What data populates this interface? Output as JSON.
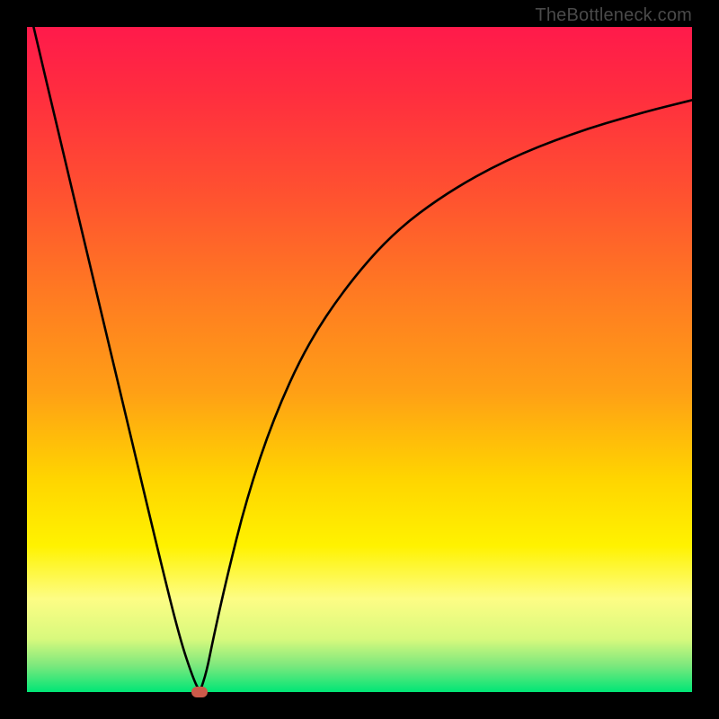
{
  "watermark": "TheBottleneck.com",
  "chart_data": {
    "type": "line",
    "title": "",
    "xlabel": "",
    "ylabel": "",
    "xlim": [
      0,
      100
    ],
    "ylim": [
      0,
      100
    ],
    "grid": false,
    "legend": false,
    "annotations": [],
    "series": [
      {
        "name": "left-branch",
        "x": [
          1,
          5,
          10,
          15,
          20,
          23,
          25,
          26
        ],
        "values": [
          100,
          83,
          62,
          41,
          20,
          8,
          2,
          0
        ]
      },
      {
        "name": "right-branch",
        "x": [
          26,
          27,
          28,
          30,
          33,
          37,
          42,
          48,
          55,
          63,
          72,
          82,
          92,
          100
        ],
        "values": [
          0,
          3,
          8,
          17,
          29,
          41,
          52,
          61,
          69,
          75,
          80,
          84,
          87,
          89
        ]
      }
    ],
    "marker": {
      "x": 26,
      "y": 0,
      "color": "#cc5a4a"
    },
    "background_gradient": {
      "top": "#ff1a4b",
      "bottom": "#00e676"
    }
  }
}
